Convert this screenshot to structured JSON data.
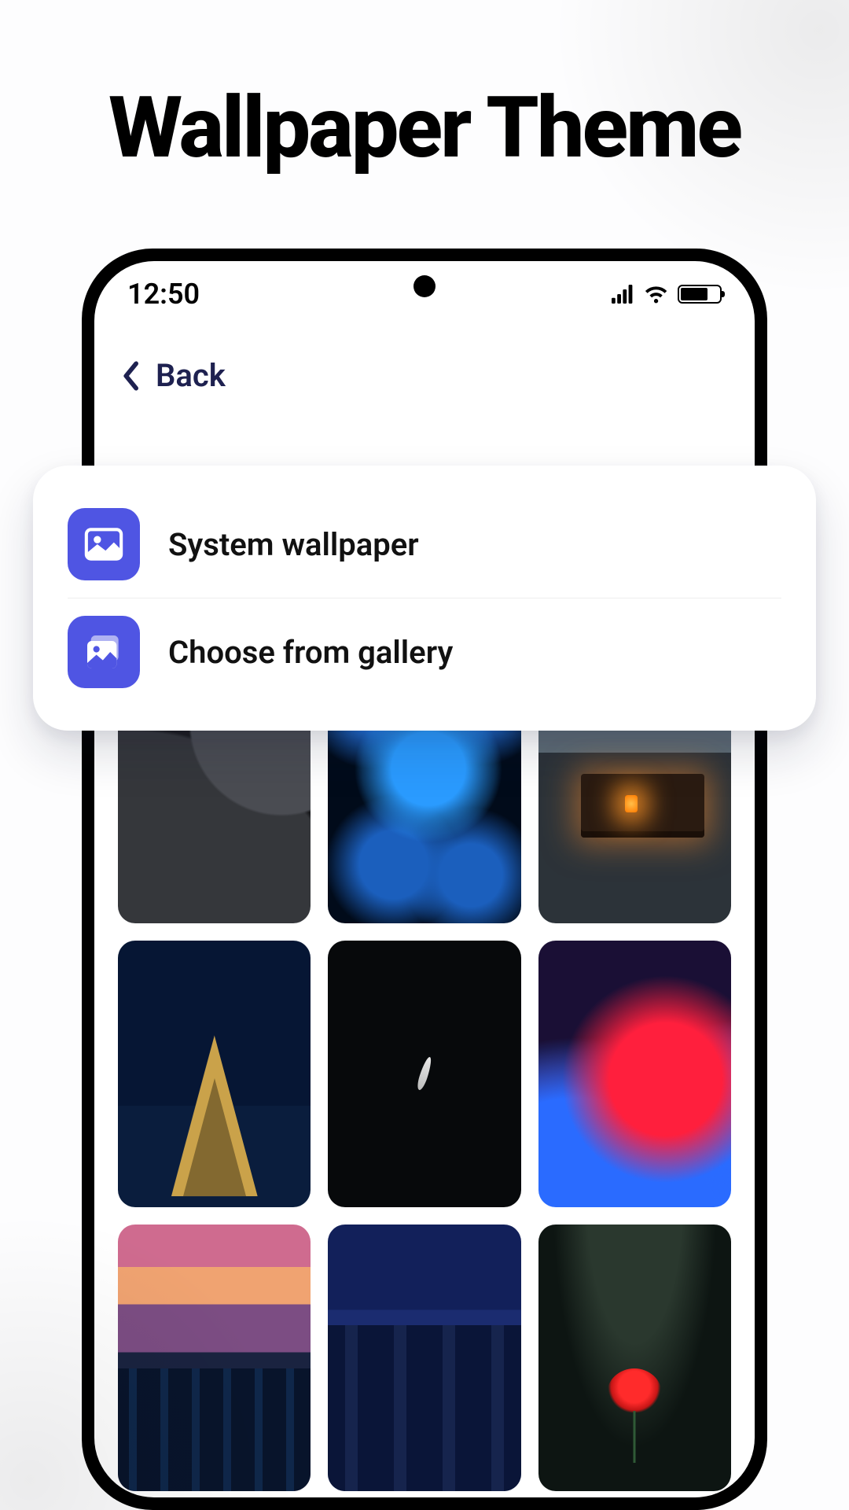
{
  "promo": {
    "title": "Wallpaper Theme"
  },
  "status": {
    "time": "12:50"
  },
  "nav": {
    "back_label": "Back"
  },
  "options": {
    "system_wallpaper": "System wallpaper",
    "choose_gallery": "Choose from gallery"
  },
  "thumbs": [
    "Abstract dark",
    "Jellyfish",
    "Cabin night",
    "Eiffel Tower",
    "Feather dark",
    "Color waves",
    "Synth city",
    "Night city",
    "Red poppy"
  ],
  "colors": {
    "accent": "#4f55e3",
    "nav_text": "#1e2150"
  }
}
